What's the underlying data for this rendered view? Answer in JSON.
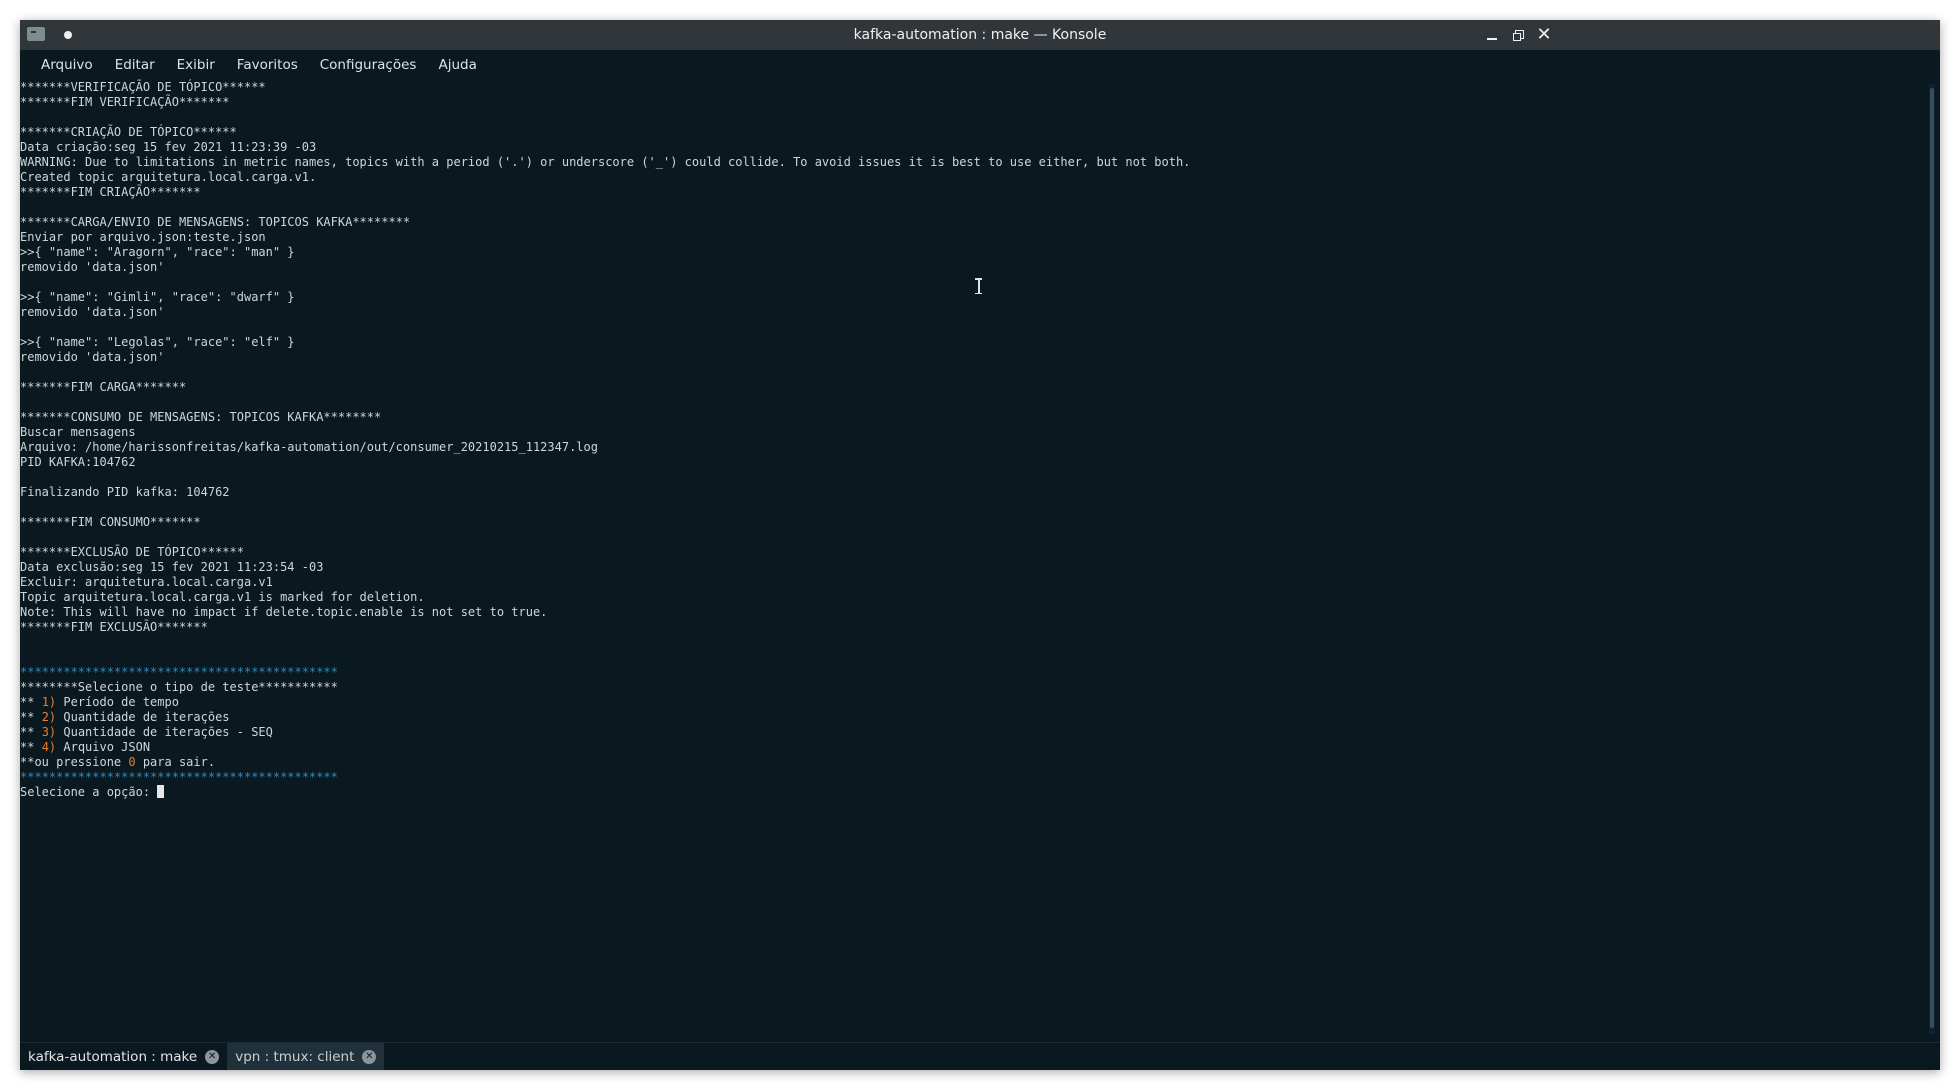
{
  "window": {
    "title": "kafka-automation : make — Konsole"
  },
  "menu": [
    "Arquivo",
    "Editar",
    "Exibir",
    "Favoritos",
    "Configurações",
    "Ajuda"
  ],
  "terminal": {
    "lines": [
      [
        {
          "t": "*******VERIFICAÇÃO DE TÓPICO******"
        }
      ],
      [
        {
          "t": "*******FIM VERIFICAÇÃO*******"
        }
      ],
      [
        {
          "t": ""
        }
      ],
      [
        {
          "t": "*******CRIAÇÃO DE TÓPICO******"
        }
      ],
      [
        {
          "t": "Data criação:seg 15 fev 2021 11:23:39 -03"
        }
      ],
      [
        {
          "t": "WARNING: Due to limitations in metric names, topics with a period ('.') or underscore ('_') could collide. To avoid issues it is best to use either, but not both."
        }
      ],
      [
        {
          "t": "Created topic arquitetura.local.carga.v1."
        }
      ],
      [
        {
          "t": "*******FIM CRIAÇÃO*******"
        }
      ],
      [
        {
          "t": ""
        }
      ],
      [
        {
          "t": "*******CARGA/ENVIO DE MENSAGENS: TOPICOS KAFKA********"
        }
      ],
      [
        {
          "t": "Enviar por arquivo.json:teste.json"
        }
      ],
      [
        {
          "t": ">>{ \"name\": \"Aragorn\", \"race\": \"man\" }"
        }
      ],
      [
        {
          "t": "removido 'data.json'"
        }
      ],
      [
        {
          "t": ""
        }
      ],
      [
        {
          "t": ">>{ \"name\": \"Gimli\", \"race\": \"dwarf\" }"
        }
      ],
      [
        {
          "t": "removido 'data.json'"
        }
      ],
      [
        {
          "t": ""
        }
      ],
      [
        {
          "t": ">>{ \"name\": \"Legolas\", \"race\": \"elf\" }"
        }
      ],
      [
        {
          "t": "removido 'data.json'"
        }
      ],
      [
        {
          "t": ""
        }
      ],
      [
        {
          "t": "*******FIM CARGA*******"
        }
      ],
      [
        {
          "t": ""
        }
      ],
      [
        {
          "t": "*******CONSUMO DE MENSAGENS: TOPICOS KAFKA********"
        }
      ],
      [
        {
          "t": "Buscar mensagens"
        }
      ],
      [
        {
          "t": "Arquivo: /home/harissonfreitas/kafka-automation/out/consumer_20210215_112347.log"
        }
      ],
      [
        {
          "t": "PID KAFKA:104762"
        }
      ],
      [
        {
          "t": ""
        }
      ],
      [
        {
          "t": "Finalizando PID kafka: 104762"
        }
      ],
      [
        {
          "t": ""
        }
      ],
      [
        {
          "t": "*******FIM CONSUMO*******"
        }
      ],
      [
        {
          "t": ""
        }
      ],
      [
        {
          "t": "*******EXCLUSÃO DE TÓPICO******"
        }
      ],
      [
        {
          "t": "Data exclusão:seg 15 fev 2021 11:23:54 -03"
        }
      ],
      [
        {
          "t": "Excluir: arquitetura.local.carga.v1"
        }
      ],
      [
        {
          "t": "Topic arquitetura.local.carga.v1 is marked for deletion."
        }
      ],
      [
        {
          "t": "Note: This will have no impact if delete.topic.enable is not set to true."
        }
      ],
      [
        {
          "t": "*******FIM EXCLUSÃO*******"
        }
      ],
      [
        {
          "t": ""
        }
      ],
      [
        {
          "t": ""
        }
      ],
      [
        {
          "t": "********************************************",
          "c": "blue"
        }
      ],
      [
        {
          "t": "********Selecione o tipo de teste***********"
        }
      ],
      [
        {
          "t": "** "
        },
        {
          "t": "1)",
          "c": "orange"
        },
        {
          "t": " Período de tempo"
        }
      ],
      [
        {
          "t": "** "
        },
        {
          "t": "2)",
          "c": "orange"
        },
        {
          "t": " Quantidade de iterações"
        }
      ],
      [
        {
          "t": "** "
        },
        {
          "t": "3)",
          "c": "orange"
        },
        {
          "t": " Quantidade de iterações - SEQ"
        }
      ],
      [
        {
          "t": "** "
        },
        {
          "t": "4)",
          "c": "orange"
        },
        {
          "t": " Arquivo JSON"
        }
      ],
      [
        {
          "t": "**ou pressione "
        },
        {
          "t": "0",
          "c": "orange"
        },
        {
          "t": " para sair."
        }
      ],
      [
        {
          "t": "********************************************",
          "c": "blue"
        }
      ],
      [
        {
          "t": "Selecione a opção: "
        },
        {
          "cursor": true
        }
      ]
    ]
  },
  "tabs": [
    {
      "label": "kafka-automation : make",
      "active": true
    },
    {
      "label": "vpn : tmux: client",
      "active": false
    }
  ],
  "colors": {
    "terminal_bg": "#0a1820",
    "foreground": "#cfd6db",
    "blue": "#2e8bc0",
    "orange": "#e77d2f",
    "titlebar": "#31363b"
  },
  "icons": {
    "app": "terminal-icon",
    "pin": "pin-dot-icon",
    "minimize": "minimize-icon",
    "maximize": "restore-icon",
    "close": "close-icon",
    "text_cursor": "ibeam-cursor-icon",
    "tab_close": "tab-close-icon"
  }
}
